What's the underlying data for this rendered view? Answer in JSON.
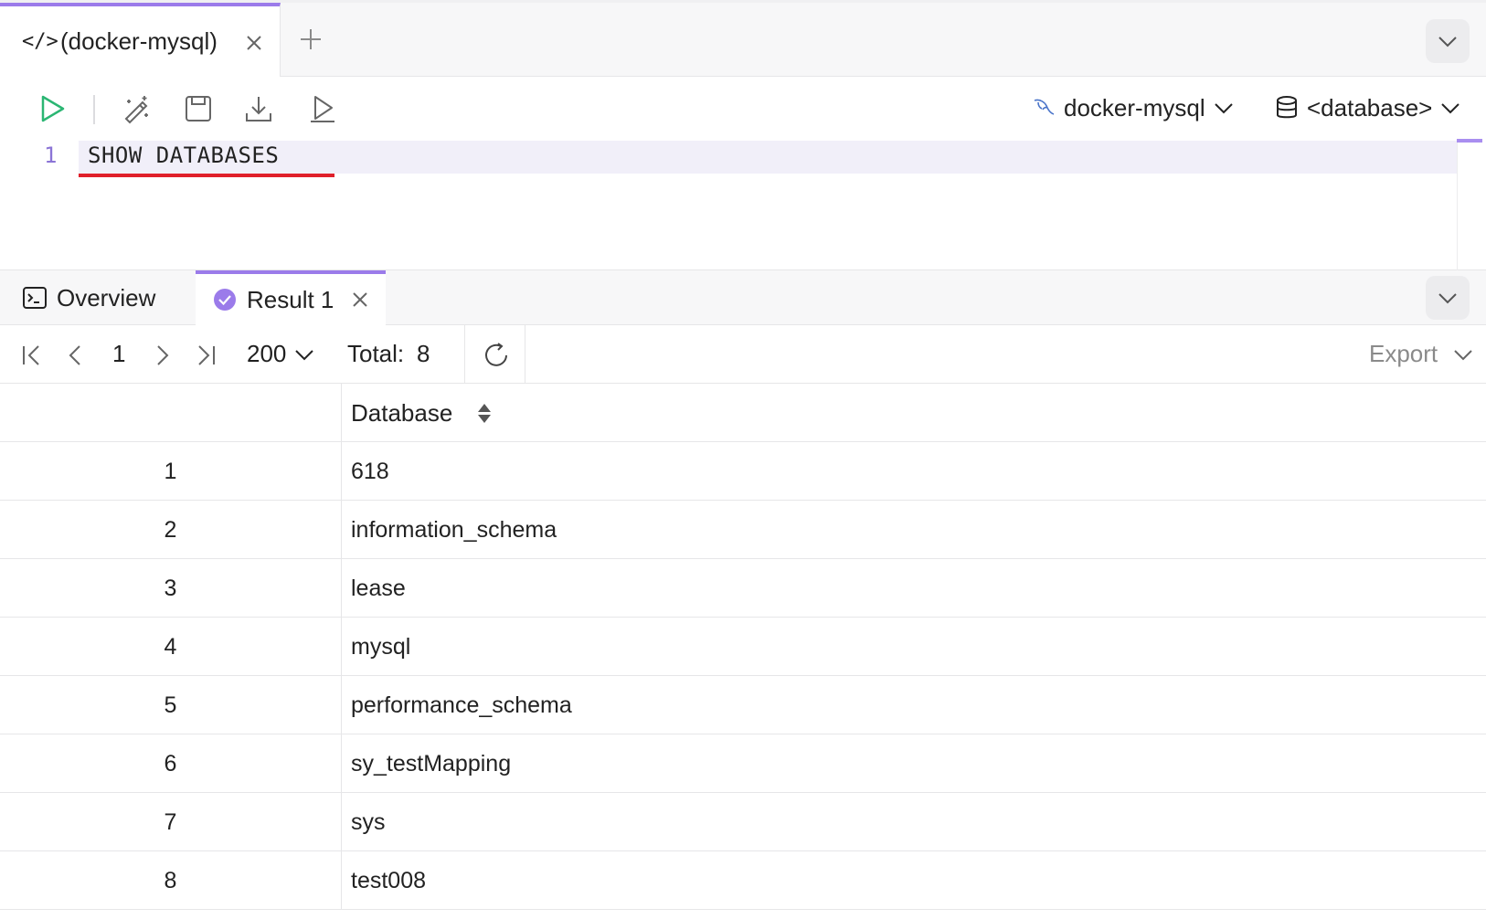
{
  "editor_tab": {
    "title": "(docker-mysql)"
  },
  "toolbar": {
    "connection": "docker-mysql",
    "database": "<database>"
  },
  "editor": {
    "line_number": "1",
    "code": "SHOW DATABASES"
  },
  "result_tabs": {
    "overview": "Overview",
    "result": "Result 1"
  },
  "pager": {
    "page": "1",
    "page_size": "200",
    "total_label": "Total:",
    "total_value": "8",
    "export": "Export"
  },
  "table": {
    "column": "Database",
    "rows": [
      {
        "index": "1",
        "value": "618"
      },
      {
        "index": "2",
        "value": "information_schema"
      },
      {
        "index": "3",
        "value": "lease"
      },
      {
        "index": "4",
        "value": "mysql"
      },
      {
        "index": "5",
        "value": "performance_schema"
      },
      {
        "index": "6",
        "value": "sy_testMapping"
      },
      {
        "index": "7",
        "value": "sys"
      },
      {
        "index": "8",
        "value": "test008"
      }
    ]
  },
  "colors": {
    "accent": "#9b7bea",
    "run": "#2bb673",
    "error_underline": "#e0202a"
  }
}
